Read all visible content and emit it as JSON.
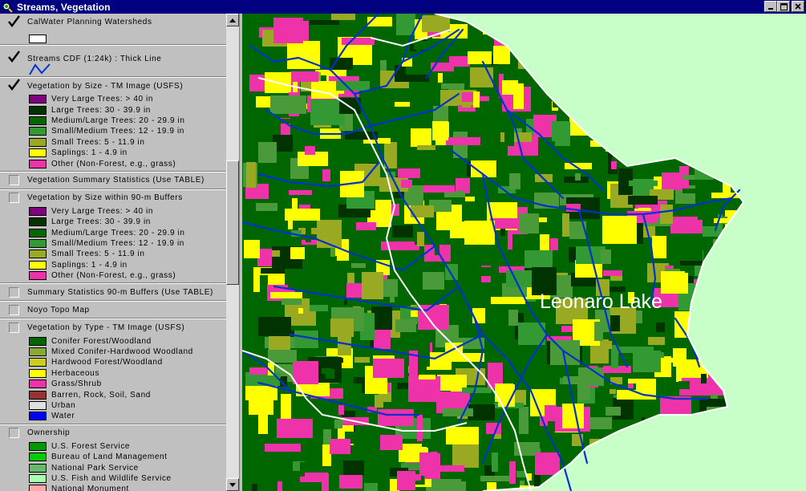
{
  "window": {
    "title": "Streams, Vegetation"
  },
  "toc": {
    "themes": [
      {
        "name": "CalWater Planning Watersheds",
        "checked": true,
        "symbol": "white-outline-box",
        "items": []
      },
      {
        "name": "Streams CDF (1:24k) : Thick Line",
        "checked": true,
        "symbol": "blue-line",
        "items": []
      },
      {
        "name": "Vegetation by Size - TM Image (USFS)",
        "checked": true,
        "items": [
          {
            "label": "Very Large Trees: > 40  in",
            "color": "#800080"
          },
          {
            "label": "Large Trees: 30 - 39.9 in",
            "color": "#003300"
          },
          {
            "label": "Medium/Large Trees: 20 - 29.9 in",
            "color": "#006600"
          },
          {
            "label": "Small/Medium Trees: 12 - 19.9 in",
            "color": "#339933"
          },
          {
            "label": "Small Trees: 5 - 11.9 in",
            "color": "#99aa22"
          },
          {
            "label": "Saplings: 1 - 4.9 in",
            "color": "#ffff00"
          },
          {
            "label": "Other (Non-Forest, e.g., grass)",
            "color": "#ee33aa"
          }
        ]
      },
      {
        "name": "Vegetation Summary Statistics (Use TABLE)",
        "checked": false,
        "items": []
      },
      {
        "name": "Vegetation by Size within 90-m Buffers",
        "checked": false,
        "items": [
          {
            "label": "Very Large Trees: > 40  in",
            "color": "#800080"
          },
          {
            "label": "Large Trees: 30 - 39.9 in",
            "color": "#003300"
          },
          {
            "label": "Medium/Large Trees: 20 - 29.9 in",
            "color": "#006600"
          },
          {
            "label": "Small/Medium Trees: 12 - 19.9 in",
            "color": "#339933"
          },
          {
            "label": "Small Trees: 5 - 11.9 in",
            "color": "#99aa22"
          },
          {
            "label": "Saplings: 1 - 4.9 in",
            "color": "#ffff00"
          },
          {
            "label": "Other (Non-Forest, e.g., grass)",
            "color": "#ee33aa"
          }
        ]
      },
      {
        "name": "Summary Statistics 90-m Buffers (Use TABLE)",
        "checked": false,
        "items": []
      },
      {
        "name": "Noyo Topo Map",
        "checked": false,
        "items": []
      },
      {
        "name": "Vegetation by Type - TM Image (USFS)",
        "checked": false,
        "items": [
          {
            "label": "Conifer Forest/Woodland",
            "color": "#006600"
          },
          {
            "label": "Mixed Conifer-Hardwood Woodland",
            "color": "#88aa33"
          },
          {
            "label": "Hardwood Forest/Woodland",
            "color": "#cccc22"
          },
          {
            "label": "Herbaceous",
            "color": "#ffff00"
          },
          {
            "label": "Grass/Shrub",
            "color": "#ee33aa"
          },
          {
            "label": "Barren, Rock, Soil, Sand",
            "color": "#993333"
          },
          {
            "label": "Urban",
            "color": "#e0e0e0"
          },
          {
            "label": "Water",
            "color": "#0000ff"
          }
        ]
      },
      {
        "name": "Ownership",
        "checked": false,
        "items": [
          {
            "label": "U.S. Forest Service",
            "color": "#009900"
          },
          {
            "label": "Bureau of Land Management",
            "color": "#00cc00"
          },
          {
            "label": "National Park Service",
            "color": "#66bb66"
          },
          {
            "label": "U.S. Fish and Wildlife Service",
            "color": "#aaffaa"
          },
          {
            "label": "National Monument",
            "color": "#ffaaaa"
          }
        ]
      }
    ]
  },
  "map": {
    "place_label": "Leonaro Lake",
    "background_color": "#c8ffc8"
  },
  "icons": {
    "app": "app-globe-icon",
    "minimize": "minimize-icon",
    "maximize": "maximize-icon",
    "close": "close-icon",
    "scroll_up": "scroll-up-arrow-icon",
    "scroll_down": "scroll-down-arrow-icon"
  }
}
